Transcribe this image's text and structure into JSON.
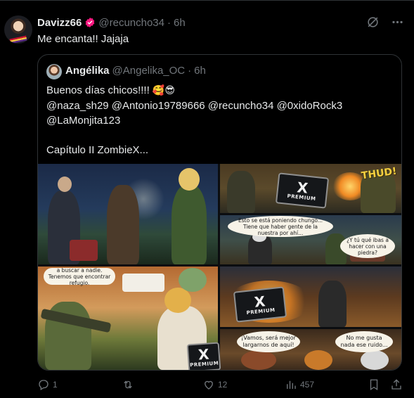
{
  "post": {
    "author_name": "Davizz66",
    "author_handle": "@recuncho34",
    "separator": "·",
    "time": "6h",
    "text": "Me encanta!! Jajaja"
  },
  "quote": {
    "author_name": "Angélika",
    "author_handle": "@Angelika_OC",
    "separator": "·",
    "time": "6h",
    "line1": "Buenos días chicos!!!! ",
    "emoji": "🥰😎",
    "line2": "@naza_sh29 @Antonio19789666 @recuncho34 @0xidoRock3\n@LaMonjita123\n\nCapítulo II ZombieX..."
  },
  "comic": {
    "sfx": "THUD!",
    "premium_x": "X",
    "premium_label": "PREMIUM",
    "bubble_1": "a buscar a nadie. Tenemos que encontrar refugio.",
    "bubble_2": "Esto se está poniendo chungo... Tiene que haber gente de la nuestra por ahí...",
    "bubble_3": "¿Y tú qué ibas a hacer con una piedra?",
    "bubble_4": "¡Vamos, será mejor largarnos de aquí!",
    "bubble_5": "No me gusta nada ese ruido..."
  },
  "actions": {
    "replies": "1",
    "reposts": "",
    "likes": "12",
    "views": "457"
  },
  "colors": {
    "background": "#000000",
    "text": "#e7e9ea",
    "muted": "#71767b",
    "border": "#2f3336",
    "verified_bg": "#f91880"
  }
}
